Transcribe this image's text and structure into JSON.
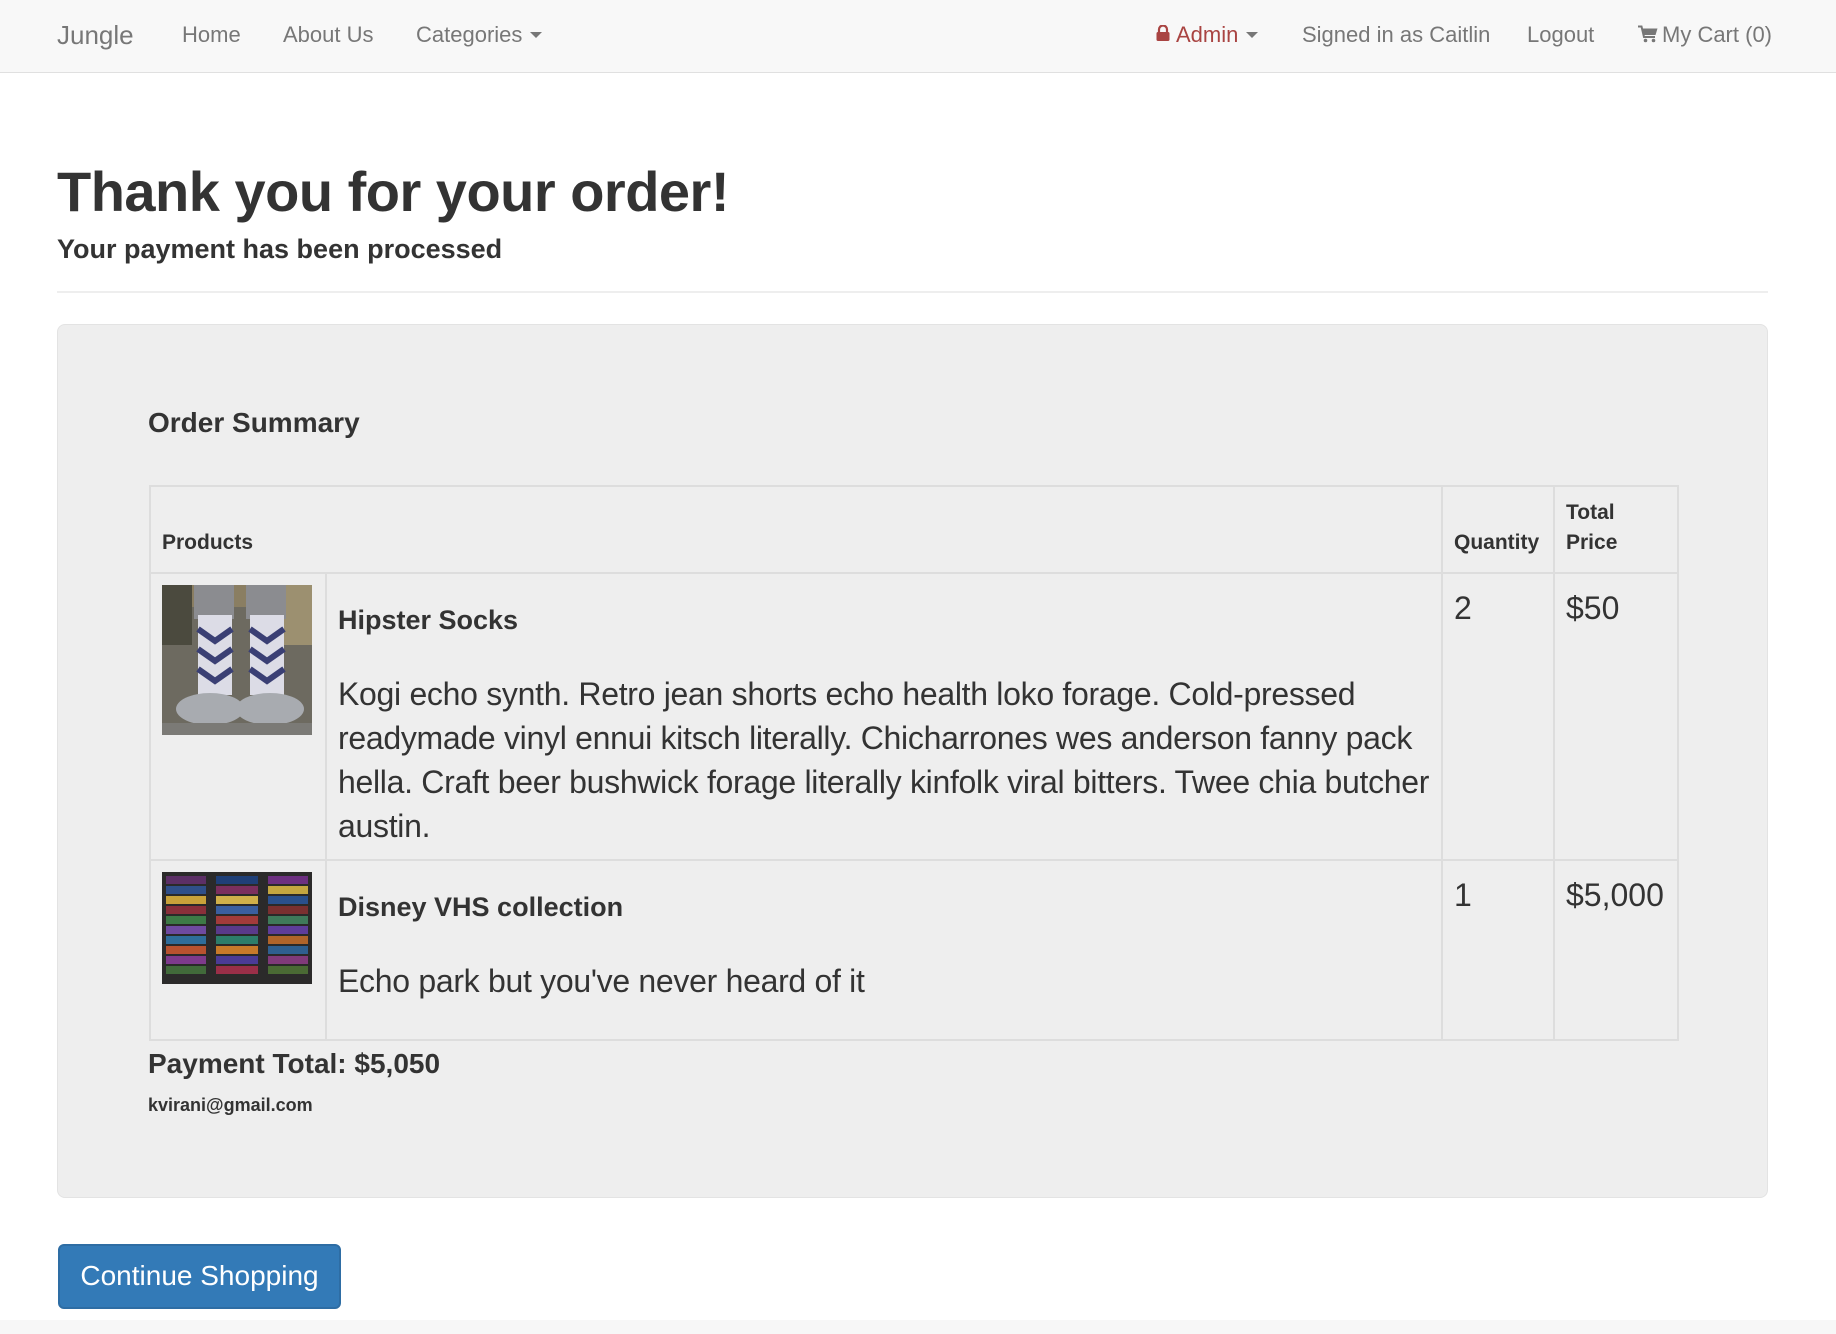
{
  "nav": {
    "brand": "Jungle",
    "home": "Home",
    "about": "About Us",
    "categories": "Categories",
    "admin": "Admin",
    "signed_in": "Signed in as Caitlin",
    "logout": "Logout",
    "cart": "My Cart (0)"
  },
  "header": {
    "title": "Thank you for your order!",
    "subtitle": "Your payment has been processed"
  },
  "summary": {
    "title": "Order Summary",
    "columns": {
      "products": "Products",
      "quantity": "Quantity",
      "total_price": "Total Price"
    },
    "items": [
      {
        "name": "Hipster Socks",
        "description": "Kogi echo synth. Retro jean shorts echo health loko forage. Cold-pressed readymade vinyl ennui kitsch literally. Chicharrones wes anderson fanny pack hella. Craft beer bushwick forage literally kinfolk viral bitters. Twee chia butcher austin.",
        "quantity": "2",
        "price": "$50"
      },
      {
        "name": "Disney VHS collection",
        "description": "Echo park but you've never heard of it",
        "quantity": "1",
        "price": "$5,000"
      }
    ],
    "payment_total": "Payment Total: $5,050",
    "email": "kvirani@gmail.com"
  },
  "actions": {
    "continue": "Continue Shopping"
  },
  "colors": {
    "navbar_bg": "#f8f8f8",
    "admin_red": "#a94442",
    "well_bg": "#eeeeee",
    "primary_button": "#337ab7"
  }
}
